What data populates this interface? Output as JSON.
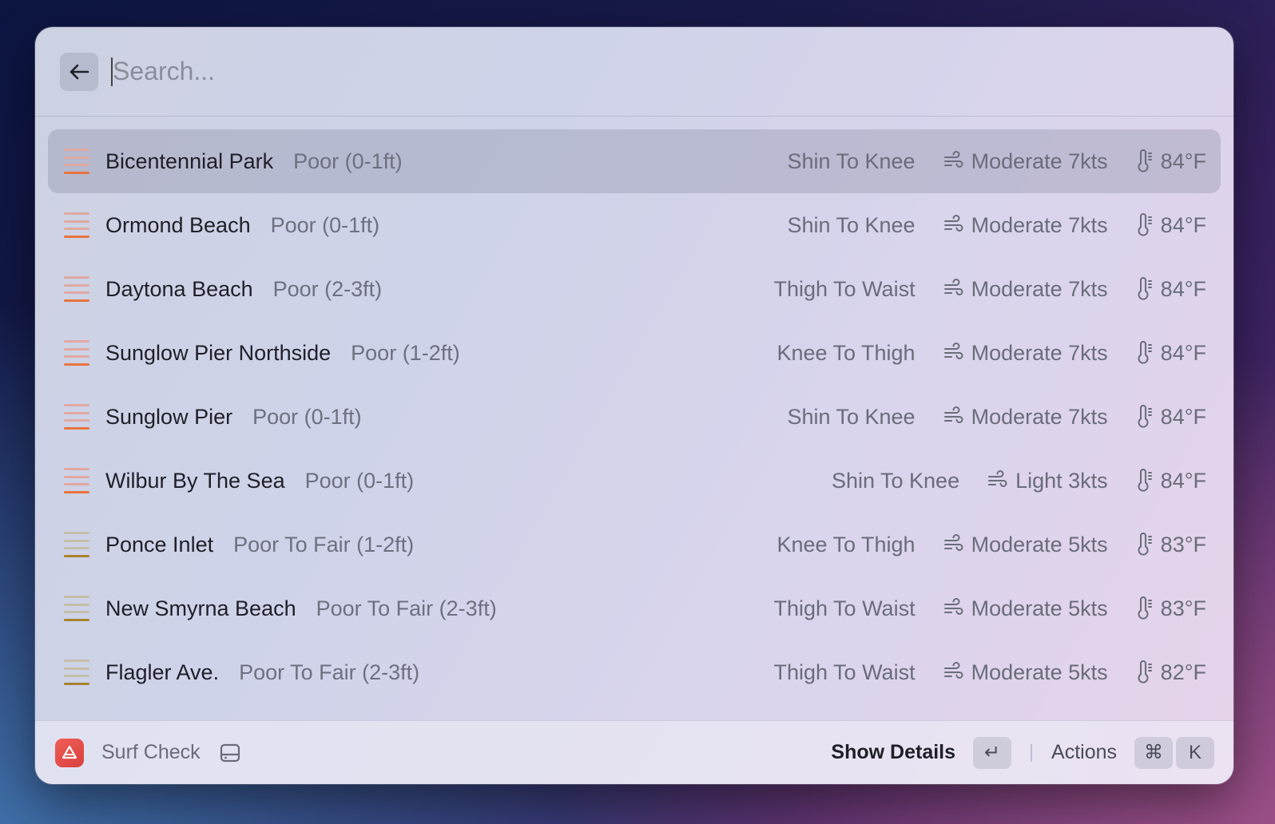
{
  "search": {
    "placeholder": "Search..."
  },
  "items": [
    {
      "title": "Bicentennial Park",
      "subtitle": "Poor (0-1ft)",
      "height": "Shin To Knee",
      "wind": "Moderate 7kts",
      "temp": "84°F",
      "rating_color": "#e8743f",
      "rating_faded": "#e0a8a2",
      "selected": true
    },
    {
      "title": "Ormond Beach",
      "subtitle": "Poor (0-1ft)",
      "height": "Shin To Knee",
      "wind": "Moderate 7kts",
      "temp": "84°F",
      "rating_color": "#e8743f",
      "rating_faded": "#e0a8a2"
    },
    {
      "title": "Daytona Beach",
      "subtitle": "Poor (2-3ft)",
      "height": "Thigh To Waist",
      "wind": "Moderate 7kts",
      "temp": "84°F",
      "rating_color": "#e8743f",
      "rating_faded": "#e0a8a2"
    },
    {
      "title": "Sunglow Pier Northside",
      "subtitle": "Poor (1-2ft)",
      "height": "Knee To Thigh",
      "wind": "Moderate 7kts",
      "temp": "84°F",
      "rating_color": "#e8743f",
      "rating_faded": "#e0a8a2"
    },
    {
      "title": "Sunglow Pier",
      "subtitle": "Poor (0-1ft)",
      "height": "Shin To Knee",
      "wind": "Moderate 7kts",
      "temp": "84°F",
      "rating_color": "#e8743f",
      "rating_faded": "#e0a8a2"
    },
    {
      "title": "Wilbur By The Sea",
      "subtitle": "Poor (0-1ft)",
      "height": "Shin To Knee",
      "wind": "Light 3kts",
      "temp": "84°F",
      "rating_color": "#e8743f",
      "rating_faded": "#e0a8a2"
    },
    {
      "title": "Ponce Inlet",
      "subtitle": "Poor To Fair (1-2ft)",
      "height": "Knee To Thigh",
      "wind": "Moderate 5kts",
      "temp": "83°F",
      "rating_color": "#a8822e",
      "rating_faded": "#c4bfa8"
    },
    {
      "title": "New Smyrna Beach",
      "subtitle": "Poor To Fair (2-3ft)",
      "height": "Thigh To Waist",
      "wind": "Moderate 5kts",
      "temp": "83°F",
      "rating_color": "#a8822e",
      "rating_faded": "#c4bfa8"
    },
    {
      "title": "Flagler Ave.",
      "subtitle": "Poor To Fair (2-3ft)",
      "height": "Thigh To Waist",
      "wind": "Moderate 5kts",
      "temp": "82°F",
      "rating_color": "#a8822e",
      "rating_faded": "#c4bfa8"
    }
  ],
  "footer": {
    "app_name": "Surf Check",
    "primary_action": "Show Details",
    "enter_key": "↵",
    "actions_label": "Actions",
    "cmd_key": "⌘",
    "k_key": "K"
  },
  "icons": {
    "back": "arrow-left-icon",
    "wind": "wind-icon",
    "temp": "thermometer-icon",
    "app": "surf-check-app-icon",
    "drive": "hard-drive-icon"
  }
}
